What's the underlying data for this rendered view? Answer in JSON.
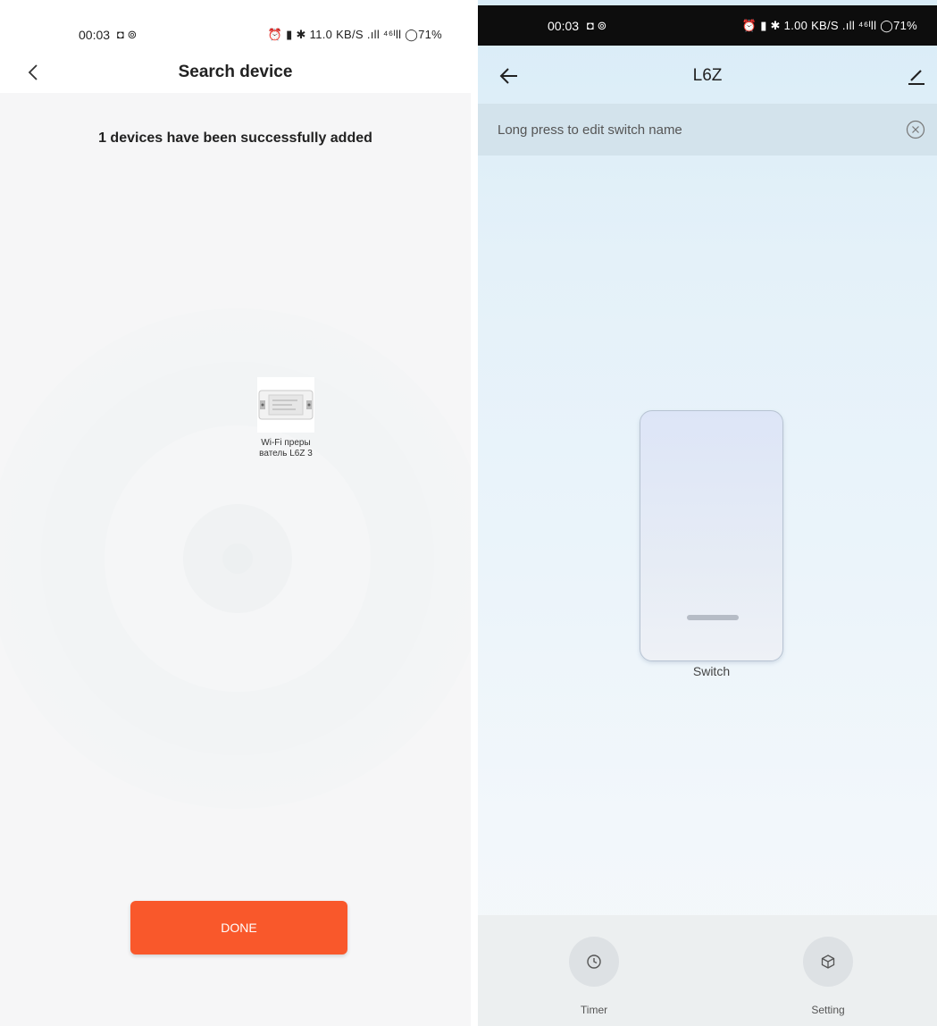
{
  "left_screen": {
    "status_bar": {
      "time": "00:03",
      "left_icons": "◘ ⊚",
      "right_text": "⏰ ▮ ✱ 11.0 KB/S .ıll ⁴⁶ᴵll ◯71%"
    },
    "header": {
      "title": "Search device"
    },
    "success_message": "1 devices have been successfully added",
    "device": {
      "name_line1": "Wi-Fi преры",
      "name_line2": "ватель L6Z 3"
    },
    "done_button": {
      "label": "DONE"
    }
  },
  "right_screen": {
    "status_bar": {
      "time": "00:03",
      "left_icons": "◘ ⊚",
      "right_text": "⏰ ▮ ✱ 1.00 KB/S .ıll ⁴⁶ᴵll ◯71%"
    },
    "header": {
      "title": "L6Z"
    },
    "hint": {
      "text": "Long press to edit switch name"
    },
    "switch": {
      "label": "Switch"
    },
    "actions": {
      "timer_label": "Timer",
      "setting_label": "Setting"
    }
  },
  "colors": {
    "accent": "#f9582b"
  },
  "icons": [
    "back-chevron-icon",
    "back-arrow-icon",
    "edit-pencil-icon",
    "close-circle-icon",
    "clock-icon",
    "cube-icon"
  ]
}
